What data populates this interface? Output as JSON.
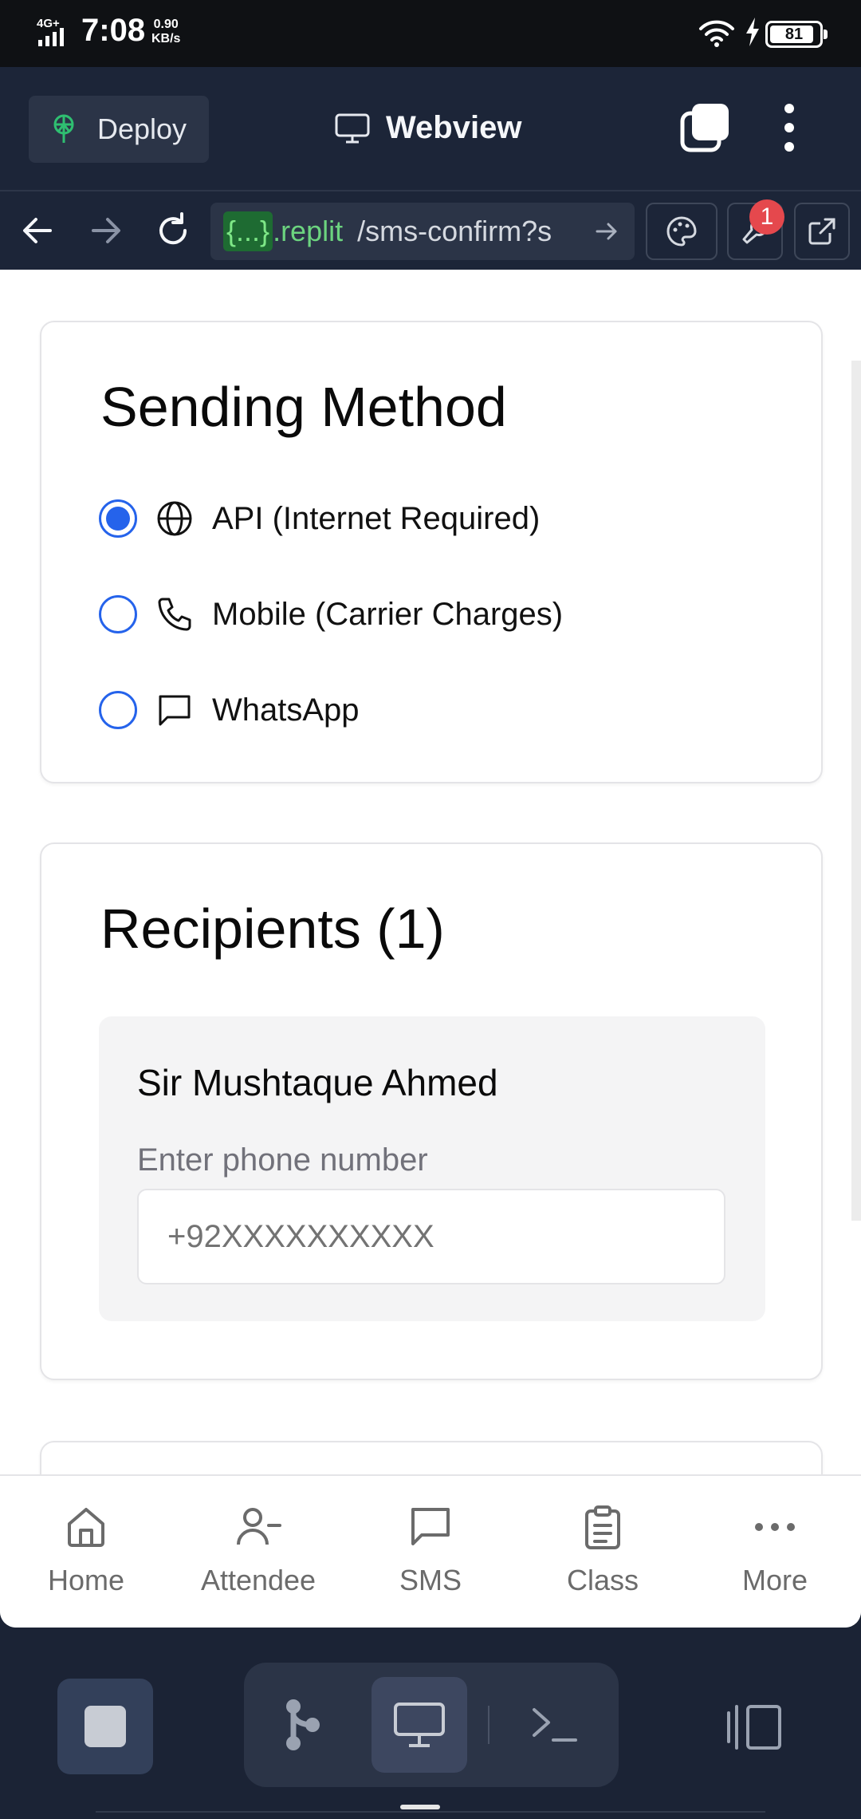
{
  "status_bar": {
    "network": "4G+",
    "time": "7:08",
    "speed_value": "0.90",
    "speed_unit": "KB/s",
    "battery": "81"
  },
  "header": {
    "deploy_label": "Deploy",
    "webview_title": "Webview"
  },
  "url_bar": {
    "domain_prefix": "{...}",
    "domain": ".replit",
    "path": "/sms-confirm?s",
    "notification_count": "1"
  },
  "sending_method": {
    "title": "Sending Method",
    "selected": "api",
    "options": [
      {
        "id": "api",
        "label": "API (Internet Required)",
        "icon": "globe-icon",
        "selected": true
      },
      {
        "id": "mobile",
        "label": "Mobile (Carrier Charges)",
        "icon": "phone-icon",
        "selected": false
      },
      {
        "id": "whatsapp",
        "label": "WhatsApp",
        "icon": "message-icon",
        "selected": false
      }
    ]
  },
  "recipients": {
    "title": "Recipients (1)",
    "items": [
      {
        "name": "Sir Mushtaque Ahmed",
        "phone_label": "Enter phone number",
        "phone_placeholder": "+92XXXXXXXXXX",
        "phone_value": ""
      }
    ]
  },
  "bottom_nav": {
    "items": [
      {
        "label": "Home",
        "icon": "home-icon"
      },
      {
        "label": "Attendee",
        "icon": "user-minus-icon"
      },
      {
        "label": "SMS",
        "icon": "message-icon"
      },
      {
        "label": "Class",
        "icon": "clipboard-icon"
      },
      {
        "label": "More",
        "icon": "more-icon"
      }
    ]
  },
  "colors": {
    "accent": "#2563eb",
    "header_bg": "#1c2538",
    "url_domain": "#6cd47f",
    "badge": "#e5484d"
  }
}
